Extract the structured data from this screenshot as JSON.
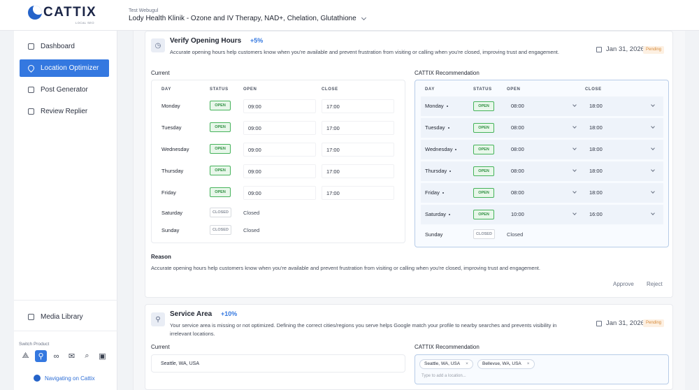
{
  "brand": {
    "logo_text": "CATTIX",
    "logo_sub": "LOCAL SEO"
  },
  "account": {
    "label": "Test Webugul",
    "name": "Lody Health Klinik - Ozone and IV Therapy, NAD+, Chelation, Glutathione"
  },
  "sidebar": {
    "items": [
      {
        "label": "Dashboard",
        "icon": "grid-icon",
        "active": false
      },
      {
        "label": "Location Optimizer",
        "icon": "location-pin-icon",
        "active": true
      },
      {
        "label": "Post Generator",
        "icon": "edit-icon",
        "active": false
      },
      {
        "label": "Review Replier",
        "icon": "star-review-icon",
        "active": false
      }
    ],
    "media_library": "Media Library",
    "switch_product_label": "Switch Product",
    "products": [
      {
        "icon": "triangle-icon",
        "active": false
      },
      {
        "icon": "person-pin-icon",
        "active": true
      },
      {
        "icon": "infinity-icon",
        "active": false
      },
      {
        "icon": "mail-icon",
        "active": false
      },
      {
        "icon": "search-off-icon",
        "active": false
      },
      {
        "icon": "image-icon",
        "active": false
      }
    ],
    "navigating": "Navigating on Cattix"
  },
  "cards": {
    "hours": {
      "title": "Verify Opening Hours",
      "pct": "+5%",
      "desc": "Accurate opening hours help customers know when you're available and prevent frustration from visiting or calling when you're closed, improving trust and engagement.",
      "date": "Jan 31, 2026",
      "status": "Pending",
      "current_label": "Current",
      "rec_label": "CATTIX Recommendation",
      "headers": {
        "day": "DAY",
        "status": "STATUS",
        "open": "OPEN",
        "close": "CLOSE"
      },
      "current_rows": [
        {
          "day": "Monday",
          "status": "OPEN",
          "open": "09:00",
          "close": "17:00"
        },
        {
          "day": "Tuesday",
          "status": "OPEN",
          "open": "09:00",
          "close": "17:00"
        },
        {
          "day": "Wednesday",
          "status": "OPEN",
          "open": "09:00",
          "close": "17:00"
        },
        {
          "day": "Thursday",
          "status": "OPEN",
          "open": "09:00",
          "close": "17:00"
        },
        {
          "day": "Friday",
          "status": "OPEN",
          "open": "09:00",
          "close": "17:00"
        },
        {
          "day": "Saturday",
          "status": "CLOSED",
          "text": "Closed"
        },
        {
          "day": "Sunday",
          "status": "CLOSED",
          "text": "Closed"
        }
      ],
      "rec_rows": [
        {
          "day": "Monday",
          "status": "OPEN",
          "open": "08:00",
          "close": "18:00"
        },
        {
          "day": "Tuesday",
          "status": "OPEN",
          "open": "08:00",
          "close": "18:00"
        },
        {
          "day": "Wednesday",
          "status": "OPEN",
          "open": "08:00",
          "close": "18:00"
        },
        {
          "day": "Thursday",
          "status": "OPEN",
          "open": "08:00",
          "close": "18:00"
        },
        {
          "day": "Friday",
          "status": "OPEN",
          "open": "08:00",
          "close": "18:00"
        },
        {
          "day": "Saturday",
          "status": "OPEN",
          "open": "10:00",
          "close": "16:00"
        },
        {
          "day": "Sunday",
          "status": "CLOSED",
          "text": "Closed"
        }
      ],
      "reason_label": "Reason",
      "reason_text": "Accurate opening hours help customers know when you're available and prevent frustration from visiting or calling when you're closed, improving trust and engagement.",
      "approve": "Approve",
      "reject": "Reject"
    },
    "service": {
      "title": "Service Area",
      "pct": "+10%",
      "desc": "Your service area is missing or not optimized. Defining the correct cities/regions you serve helps Google match your profile to nearby searches and prevents visibility in irrelevant locations.",
      "date": "Jan 31, 2026",
      "status": "Pending",
      "current_label": "Current",
      "rec_label": "CATTIX Recommendation",
      "current_value": "Seattle, WA, USA",
      "rec_chips": [
        "Seattle, WA, USA",
        "Bellevue, WA, USA"
      ],
      "input_placeholder": "Type to add a location..."
    }
  }
}
